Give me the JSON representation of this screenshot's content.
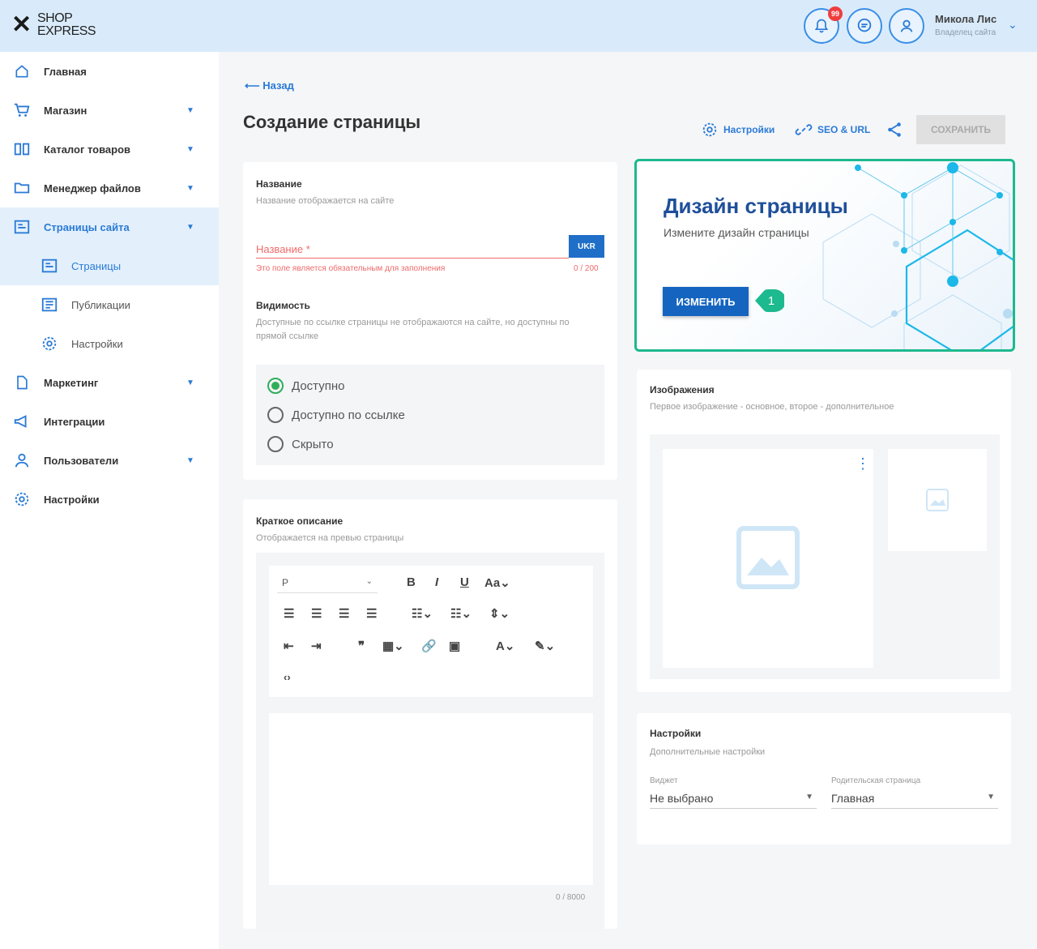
{
  "header": {
    "logo_line1": "SHOP",
    "logo_line2": "EXPRESS",
    "notifications_count": "99",
    "user_name": "Микола Лис",
    "user_role": "Владелец сайта"
  },
  "sidebar": {
    "items": [
      {
        "label": "Главная"
      },
      {
        "label": "Магазин"
      },
      {
        "label": "Каталог товаров"
      },
      {
        "label": "Менеджер файлов"
      },
      {
        "label": "Страницы сайта"
      },
      {
        "label": "Страницы"
      },
      {
        "label": "Публикации"
      },
      {
        "label": "Настройки"
      },
      {
        "label": "Маркетинг"
      },
      {
        "label": "Интеграции"
      },
      {
        "label": "Пользователи"
      },
      {
        "label": "Настройки"
      }
    ]
  },
  "main": {
    "back_label": "Назад",
    "title": "Создание страницы",
    "toolbar": {
      "settings_label": "Настройки",
      "seo_label": "SEO & URL",
      "save_label": "СОХРАНИТЬ"
    }
  },
  "name_card": {
    "title": "Название",
    "subtitle": "Название отображается на сайте",
    "field_label": "Название *",
    "lang_button": "UKR",
    "error": "Это поле является обязательным для заполнения",
    "counter": "0 / 200",
    "visibility_title": "Видимость",
    "visibility_sub": "Доступные по ссылке страницы не отображаются на сайте, но доступны по прямой ссылке",
    "options": [
      {
        "label": "Доступно",
        "selected": true
      },
      {
        "label": "Доступно по ссылке",
        "selected": false
      },
      {
        "label": "Скрыто",
        "selected": false
      }
    ]
  },
  "description_card": {
    "title": "Краткое описание",
    "subtitle": "Отображается на превью страницы",
    "format_value": "P",
    "counter": "0 / 8000"
  },
  "design_card": {
    "title": "Дизайн страницы",
    "subtitle": "Измените дизайн страницы",
    "button": "ИЗМЕНИТЬ",
    "step": "1"
  },
  "images_card": {
    "title": "Изображения",
    "subtitle": "Первое изображение - основное, второе - дополнительное"
  },
  "settings_card": {
    "title": "Настройки",
    "subtitle": "Дополнительные настройки",
    "widget_label": "Виджет",
    "widget_value": "Не выбрано",
    "parent_label": "Родительская страница",
    "parent_value": "Главная"
  }
}
